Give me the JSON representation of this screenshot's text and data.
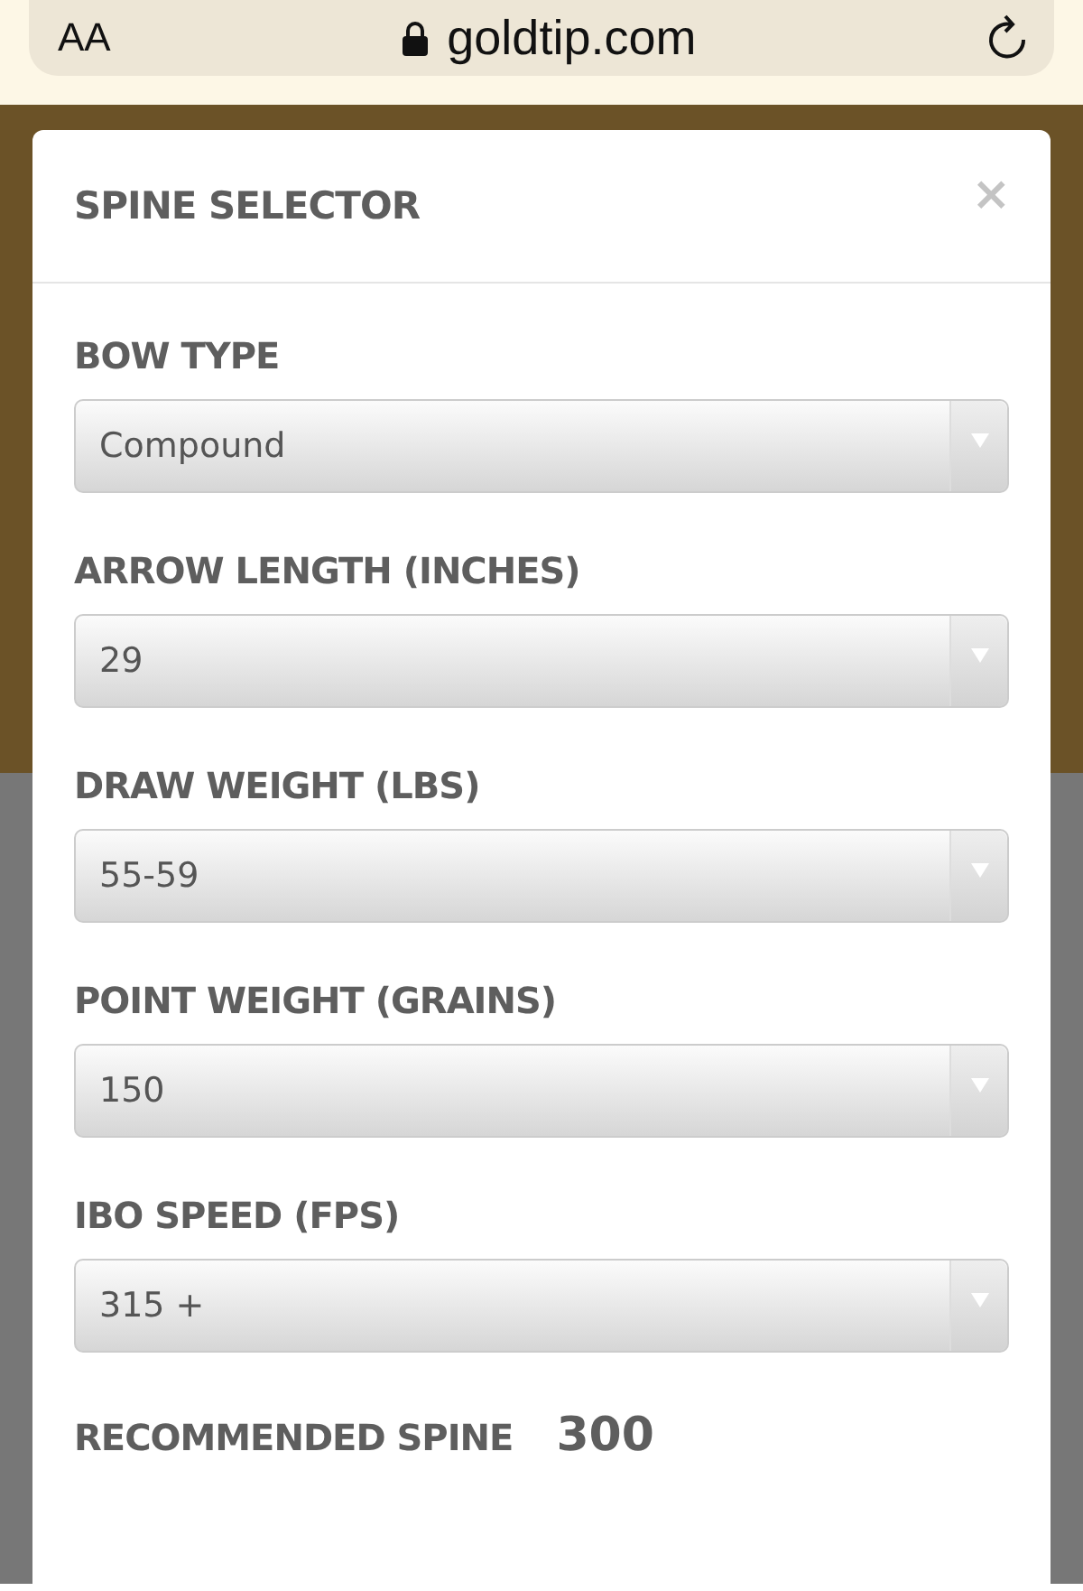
{
  "browser_bar": {
    "text_size_button": "AA",
    "url": "goldtip.com"
  },
  "modal": {
    "title": "SPINE SELECTOR",
    "close": "×",
    "fields": [
      {
        "label": "BOW TYPE",
        "value": "Compound"
      },
      {
        "label": "ARROW LENGTH (INCHES)",
        "value": "29"
      },
      {
        "label": "DRAW WEIGHT (LBS)",
        "value": "55-59"
      },
      {
        "label": "POINT WEIGHT (GRAINS)",
        "value": "150"
      },
      {
        "label": "IBO SPEED (FPS)",
        "value": "315 +"
      }
    ],
    "result": {
      "label": "RECOMMENDED SPINE",
      "value": "300"
    }
  }
}
